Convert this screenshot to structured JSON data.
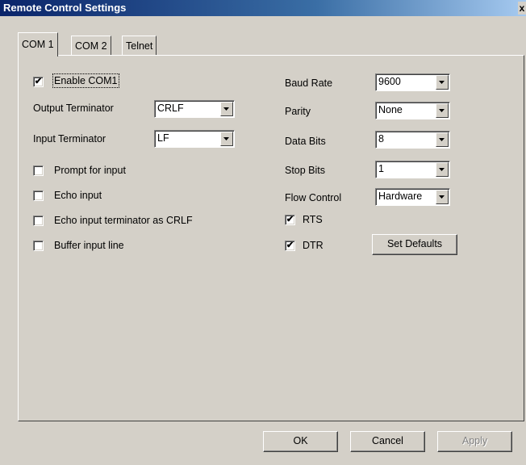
{
  "window": {
    "title": "Remote Control Settings",
    "close_glyph": "x"
  },
  "tabs": [
    {
      "label": "COM 1",
      "active": true
    },
    {
      "label": "COM 2",
      "active": false
    },
    {
      "label": "Telnet",
      "active": false
    }
  ],
  "left": {
    "enable_com1": {
      "label": "Enable COM1",
      "checked": true
    },
    "output_terminator": {
      "label": "Output Terminator",
      "value": "CRLF"
    },
    "input_terminator": {
      "label": "Input Terminator",
      "value": "LF"
    },
    "prompt_for_input": {
      "label": "Prompt for input",
      "checked": false
    },
    "echo_input": {
      "label": "Echo input",
      "checked": false
    },
    "echo_terminator": {
      "label": "Echo input terminator as CRLF",
      "checked": false
    },
    "buffer_input": {
      "label": "Buffer input line",
      "checked": false
    }
  },
  "right": {
    "baud_rate": {
      "label": "Baud Rate",
      "value": "9600"
    },
    "parity": {
      "label": "Parity",
      "value": "None"
    },
    "data_bits": {
      "label": "Data Bits",
      "value": "8"
    },
    "stop_bits": {
      "label": "Stop Bits",
      "value": "1"
    },
    "flow_control": {
      "label": "Flow Control",
      "value": "Hardware"
    },
    "rts": {
      "label": "RTS",
      "checked": true
    },
    "dtr": {
      "label": "DTR",
      "checked": true
    },
    "set_defaults": "Set Defaults"
  },
  "buttons": {
    "ok": "OK",
    "cancel": "Cancel",
    "apply": "Apply"
  },
  "check_glyph": "✔"
}
